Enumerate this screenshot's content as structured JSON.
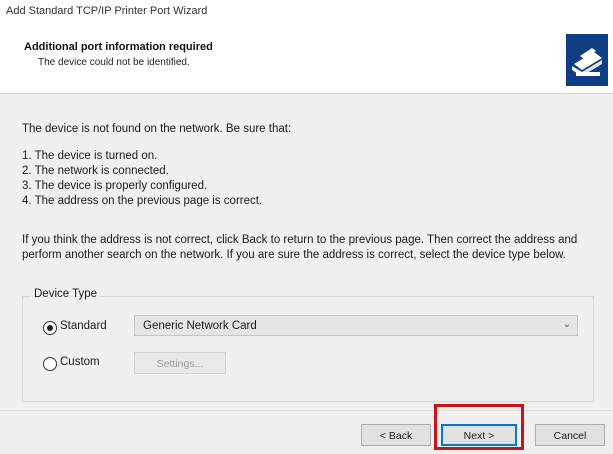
{
  "window": {
    "title": "Add Standard TCP/IP Printer Port Wizard"
  },
  "header": {
    "title": "Additional port information required",
    "subtitle": "The device could not be identified.",
    "icon": "printer-icon"
  },
  "content": {
    "intro": "The device is not found on the network.  Be sure that:",
    "checklist": [
      "1.  The device is turned on.",
      "2.  The network is connected.",
      "3.  The device is properly configured.",
      "4.  The address on the previous page is correct."
    ],
    "paragraph": "If you think the address is not correct, click Back to return to the previous page.  Then correct the address and perform another search on the network.  If you are sure the address is correct, select the device type below."
  },
  "device_type": {
    "legend": "Device Type",
    "standard_label": "Standard",
    "custom_label": "Custom",
    "selected": "standard",
    "dropdown_value": "Generic Network Card",
    "settings_label": "Settings..."
  },
  "footer": {
    "back_label": "< Back",
    "next_label": "Next >",
    "cancel_label": "Cancel"
  },
  "colors": {
    "highlight": "#c8141a",
    "focus": "#0078d7",
    "panel": "#f0f0f0"
  }
}
